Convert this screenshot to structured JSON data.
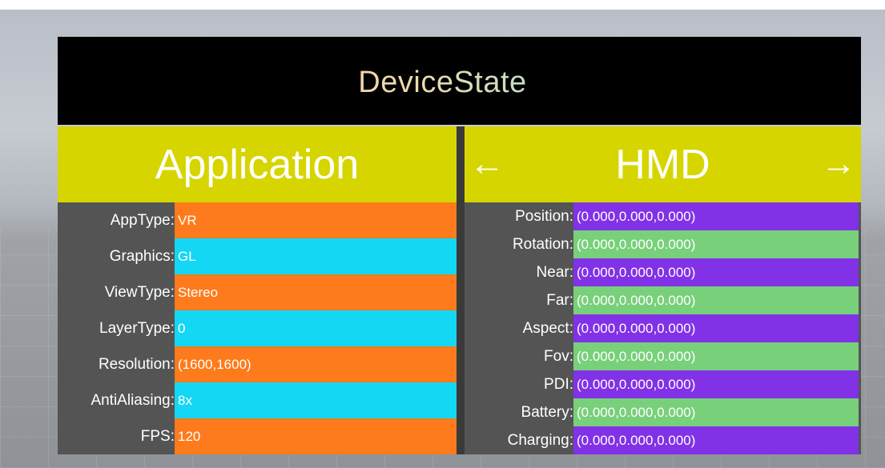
{
  "title": "DeviceState",
  "application": {
    "header": "Application",
    "rows": [
      {
        "label": "AppType:",
        "value": "VR",
        "color": "#fd7b1c"
      },
      {
        "label": "Graphics:",
        "value": "GL",
        "color": "#14d7f3"
      },
      {
        "label": "ViewType:",
        "value": "Stereo",
        "color": "#fd7b1c"
      },
      {
        "label": "LayerType:",
        "value": "0",
        "color": "#14d7f3"
      },
      {
        "label": "Resolution:",
        "value": "(1600,1600)",
        "color": "#fd7b1c"
      },
      {
        "label": "AntiAliasing:",
        "value": "8x",
        "color": "#14d7f3"
      },
      {
        "label": "FPS:",
        "value": "120",
        "color": "#fd7b1c"
      }
    ]
  },
  "hmd": {
    "header": "HMD",
    "prev_icon": "arrow-left-icon",
    "next_icon": "arrow-right-icon",
    "prev_glyph": "←",
    "next_glyph": "→",
    "rows": [
      {
        "label": "Position:",
        "value": "(0.000,0.000,0.000)",
        "color": "#8131e6"
      },
      {
        "label": "Rotation:",
        "value": "(0.000,0.000,0.000)",
        "color": "#78d07a"
      },
      {
        "label": "Near:",
        "value": "(0.000,0.000,0.000)",
        "color": "#8131e6"
      },
      {
        "label": "Far:",
        "value": "(0.000,0.000,0.000)",
        "color": "#78d07a"
      },
      {
        "label": "Aspect:",
        "value": "(0.000,0.000,0.000)",
        "color": "#8131e6"
      },
      {
        "label": "Fov:",
        "value": "(0.000,0.000,0.000)",
        "color": "#78d07a"
      },
      {
        "label": "PDI:",
        "value": "(0.000,0.000,0.000)",
        "color": "#8131e6"
      },
      {
        "label": "Battery:",
        "value": "(0.000,0.000,0.000)",
        "color": "#78d07a"
      },
      {
        "label": "Charging:",
        "value": "(0.000,0.000,0.000)",
        "color": "#8131e6"
      }
    ]
  },
  "colors": {
    "header_bg": "#d6d500",
    "panel_bg": "#545454",
    "title_bg": "#000000"
  }
}
